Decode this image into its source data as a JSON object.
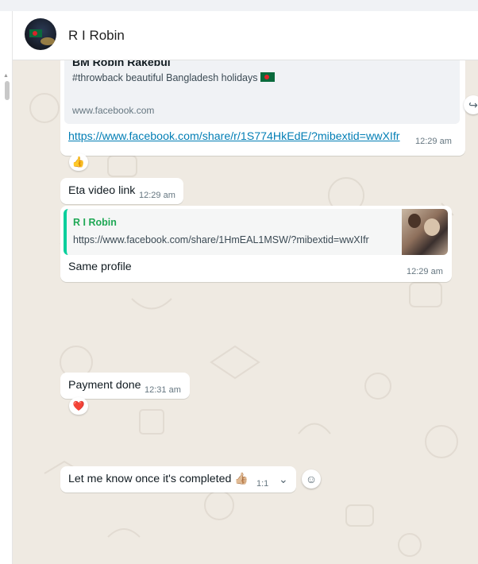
{
  "contact": {
    "name": "R I Robin"
  },
  "messages": [
    {
      "preview": {
        "title": "BM Robin Rakebul",
        "description": "#throwback beautiful Bangladesh holidays",
        "domain": "www.facebook.com"
      },
      "link": "https://www.facebook.com/share/r/1S774HkEdE/?mibextid=wwXIfr",
      "time": "12:29 am",
      "reaction": "👍"
    },
    {
      "text": "Eta video link",
      "time": "12:29 am"
    },
    {
      "quote": {
        "author": "R I Robin",
        "text": "https://www.facebook.com/share/1HmEAL1MSW/?mibextid=wwXIfr"
      },
      "text": "Same profile",
      "time": "12:29 am"
    },
    {
      "text": "Payment done",
      "time": "12:31 am",
      "reaction": "❤️"
    },
    {
      "text": "Let me know once it's completed 👍🏼",
      "time": "1:1"
    }
  ],
  "icons": {
    "forward": "forward-icon",
    "emoji": "emoji-icon",
    "dropdown": "chevron-down-icon"
  },
  "colors": {
    "chat_background": "#efeae2",
    "bubble": "#ffffff",
    "link": "#027eb5",
    "quote_bar": "#06cf9c"
  }
}
